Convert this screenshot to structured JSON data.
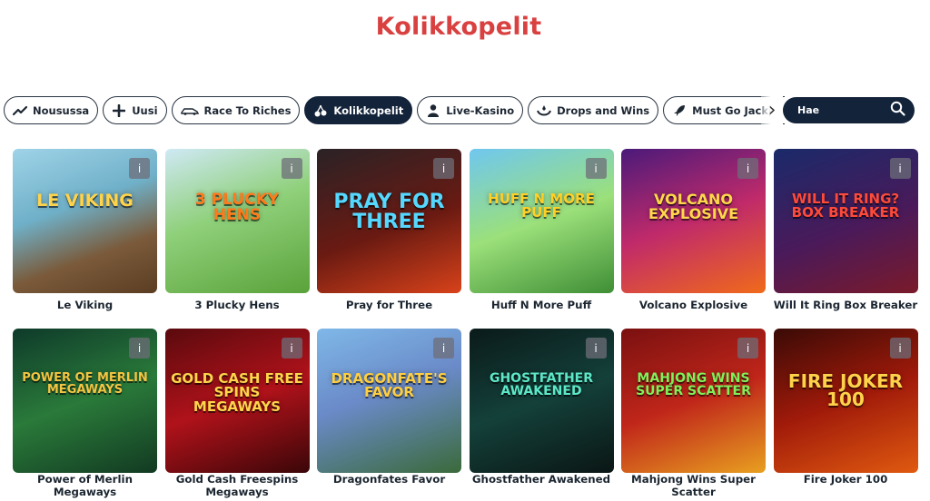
{
  "page_title": "Kolikkopelit",
  "filters": [
    {
      "label": "Nousussa",
      "icon": "trending-up-icon",
      "active": false
    },
    {
      "label": "Uusi",
      "icon": "plus-icon",
      "active": false
    },
    {
      "label": "Race To Riches",
      "icon": "race-car-icon",
      "active": false
    },
    {
      "label": "Kolikkopelit",
      "icon": "cherries-icon",
      "active": true
    },
    {
      "label": "Live-Kasino",
      "icon": "dealer-icon",
      "active": false
    },
    {
      "label": "Drops and Wins",
      "icon": "drops-icon",
      "active": false
    },
    {
      "label": "Must Go Jackpots",
      "icon": "rocket-icon",
      "active": false
    }
  ],
  "search": {
    "placeholder": "Hae",
    "icon": "search-icon"
  },
  "games": [
    {
      "name": "Le Viking",
      "art": "LE VIKING",
      "bg": "linear-gradient(160deg,#9fd3e8 0%,#6fb0c8 40%,#7a5a3a 70%,#5b3d22 100%)",
      "fg": "#ffd34a"
    },
    {
      "name": "3 Plucky Hens",
      "art": "3 PLUCKY HENS",
      "bg": "linear-gradient(160deg,#cfe9f5 0%,#8fd07a 45%,#5aa23a 100%)",
      "fg": "#ff7a1a"
    },
    {
      "name": "Pray for Three",
      "art": "PRAY FOR THREE",
      "bg": "linear-gradient(160deg,#2a2226 0%,#6a1a12 55%,#d8421a 100%)",
      "fg": "#55d8ff"
    },
    {
      "name": "Huff N More Puff",
      "art": "HUFF N MORE PUFF",
      "bg": "linear-gradient(160deg,#6fc7f0 0%,#9be07a 50%,#3f8e35 100%)",
      "fg": "#ffd026"
    },
    {
      "name": "Volcano Explosive",
      "art": "VOLCANO EXPLOSIVE",
      "bg": "linear-gradient(160deg,#4a1a7a 0%,#c02a6a 50%,#f06a1a 100%)",
      "fg": "#ffd84a"
    },
    {
      "name": "Will It Ring Box Breaker",
      "art": "WILL IT RING? BOX BREAKER",
      "bg": "linear-gradient(160deg,#1a2a6a 0%,#4a1a5a 55%,#7a1a2a 100%)",
      "fg": "#ff4a3a"
    },
    {
      "name": "Power of Merlin Megaways",
      "art": "POWER OF MERLIN MEGAWAYS",
      "bg": "linear-gradient(160deg,#0e3a2a 0%,#2a7a3a 50%,#123a22 100%)",
      "fg": "#f4c542"
    },
    {
      "name": "Gold Cash Freespins Megaways",
      "art": "GOLD CASH FREE SPINS MEGAWAYS",
      "bg": "linear-gradient(160deg,#5a0a0e 0%,#b0121a 50%,#3a0608 100%)",
      "fg": "#ffd54a"
    },
    {
      "name": "Dragonfates Favor",
      "art": "DRAGONFATE'S FAVOR",
      "bg": "linear-gradient(160deg,#7fb8e8 0%,#6a8ac8 45%,#3a6a3a 100%)",
      "fg": "#ffcf40"
    },
    {
      "name": "Ghostfather Awakened",
      "art": "GHOSTFATHER AWAKENED",
      "bg": "linear-gradient(160deg,#0a1a1a 0%,#14403a 50%,#0a1614 100%)",
      "fg": "#5de8c8"
    },
    {
      "name": "Mahjong Wins Super Scatter",
      "art": "MAHJONG WINS SUPER SCATTER",
      "bg": "linear-gradient(160deg,#7a1010 0%,#c0261a 50%,#e8a020 100%)",
      "fg": "#7ff05a"
    },
    {
      "name": "Fire Joker 100",
      "art": "FIRE JOKER 100",
      "bg": "linear-gradient(160deg,#3a0a06 0%,#a01a0a 50%,#e05a10 100%)",
      "fg": "#ffd24a"
    }
  ]
}
